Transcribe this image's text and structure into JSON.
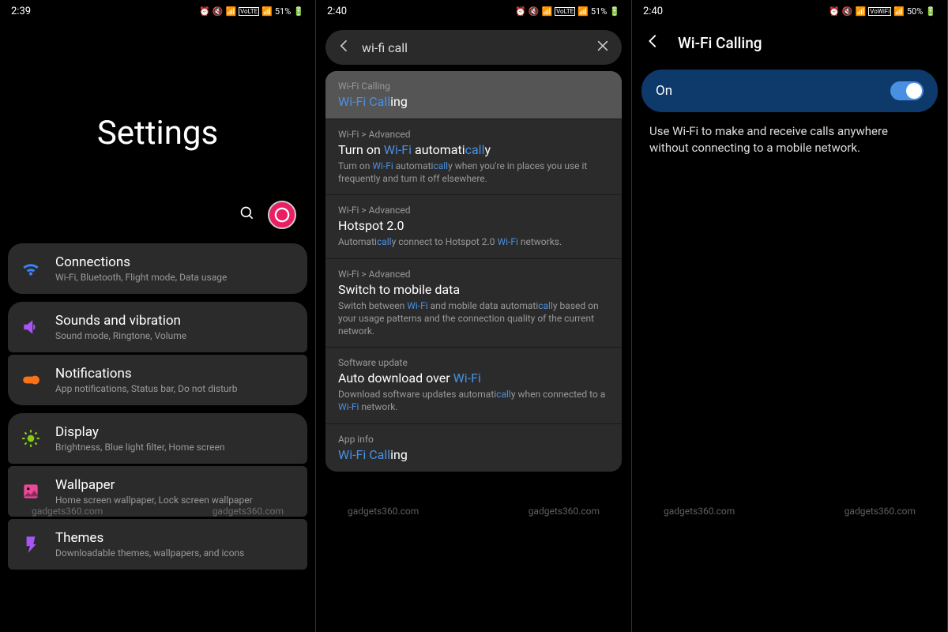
{
  "watermark": "gadgets360.com",
  "screen1": {
    "time": "2:39",
    "battery": "51%",
    "title": "Settings",
    "items": [
      {
        "icon": "wifi",
        "color": "#3b82f6",
        "title": "Connections",
        "sub": "Wi-Fi, Bluetooth, Flight mode, Data usage"
      },
      {
        "icon": "sound",
        "color": "#a855f7",
        "title": "Sounds and vibration",
        "sub": "Sound mode, Ringtone, Volume"
      },
      {
        "icon": "notif",
        "color": "#f97316",
        "title": "Notifications",
        "sub": "App notifications, Status bar, Do not disturb"
      },
      {
        "icon": "display",
        "color": "#84cc16",
        "title": "Display",
        "sub": "Brightness, Blue light filter, Home screen"
      },
      {
        "icon": "wallpaper",
        "color": "#ec4899",
        "title": "Wallpaper",
        "sub": "Home screen wallpaper, Lock screen wallpaper"
      },
      {
        "icon": "themes",
        "color": "#a855f7",
        "title": "Themes",
        "sub": "Downloadable themes, wallpapers, and icons"
      }
    ]
  },
  "screen2": {
    "time": "2:40",
    "battery": "51%",
    "query": "wi-fi call",
    "results": [
      {
        "crumb": "Wi-Fi Calling",
        "title_html": "<span class='hl'>Wi-Fi Call</span>ing",
        "highlighted": true
      },
      {
        "crumb": "Wi-Fi > Advanced",
        "title_html": "Turn on <span class='hl'>Wi-Fi</span> automati<span class='hl'>call</span>y",
        "desc_html": "Turn on <span class='hl'>Wi-Fi</span> automati<span class='hl'>call</span>y when you're in places you use it frequently and turn it off elsewhere."
      },
      {
        "crumb": "Wi-Fi > Advanced",
        "title_html": "Hotspot 2.0",
        "desc_html": "Automati<span class='hl'>call</span>y connect to Hotspot 2.0 <span class='hl'>Wi-Fi</span> networks."
      },
      {
        "crumb": "Wi-Fi > Advanced",
        "title_html": "Switch to mobile data",
        "desc_html": "Switch between <span class='hl'>Wi-Fi</span> and mobile data automati<span class='hl'>call</span>y based on your usage patterns and the connection quality of the current network."
      },
      {
        "crumb": "Software update",
        "title_html": "Auto download over <span class='hl'>Wi-Fi</span>",
        "desc_html": "Download software updates automati<span class='hl'>call</span>y when connected to a <span class='hl'>Wi-Fi</span> network."
      },
      {
        "crumb": "App info",
        "title_html": "<span class='hl'>Wi-Fi Call</span>ing"
      }
    ]
  },
  "screen3": {
    "time": "2:40",
    "battery": "50%",
    "title": "Wi-Fi Calling",
    "toggle_label": "On",
    "toggle_on": true,
    "description": "Use Wi-Fi to make and receive calls anywhere without connecting to a mobile network."
  }
}
